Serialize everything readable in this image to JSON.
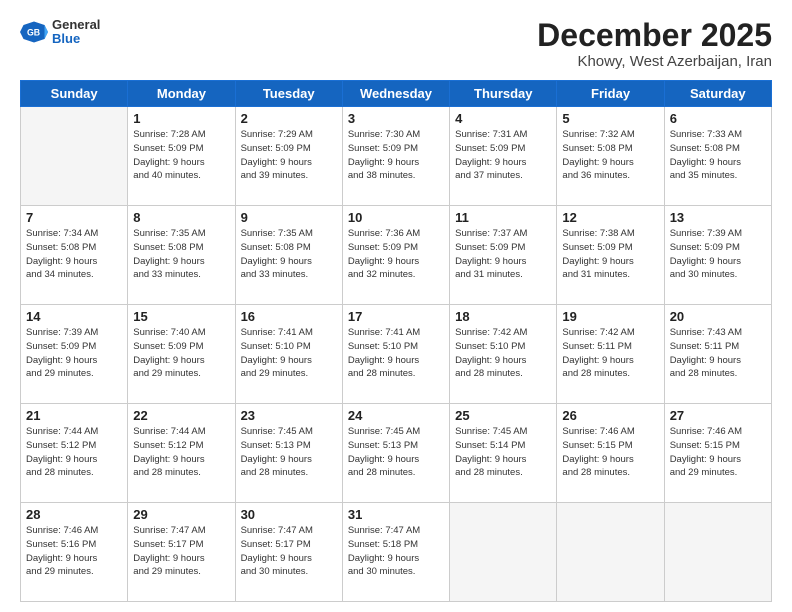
{
  "logo": {
    "general": "General",
    "blue": "Blue"
  },
  "header": {
    "month": "December 2025",
    "location": "Khowy, West Azerbaijan, Iran"
  },
  "weekdays": [
    "Sunday",
    "Monday",
    "Tuesday",
    "Wednesday",
    "Thursday",
    "Friday",
    "Saturday"
  ],
  "weeks": [
    [
      {
        "day": "",
        "info": ""
      },
      {
        "day": "1",
        "info": "Sunrise: 7:28 AM\nSunset: 5:09 PM\nDaylight: 9 hours\nand 40 minutes."
      },
      {
        "day": "2",
        "info": "Sunrise: 7:29 AM\nSunset: 5:09 PM\nDaylight: 9 hours\nand 39 minutes."
      },
      {
        "day": "3",
        "info": "Sunrise: 7:30 AM\nSunset: 5:09 PM\nDaylight: 9 hours\nand 38 minutes."
      },
      {
        "day": "4",
        "info": "Sunrise: 7:31 AM\nSunset: 5:09 PM\nDaylight: 9 hours\nand 37 minutes."
      },
      {
        "day": "5",
        "info": "Sunrise: 7:32 AM\nSunset: 5:08 PM\nDaylight: 9 hours\nand 36 minutes."
      },
      {
        "day": "6",
        "info": "Sunrise: 7:33 AM\nSunset: 5:08 PM\nDaylight: 9 hours\nand 35 minutes."
      }
    ],
    [
      {
        "day": "7",
        "info": "Sunrise: 7:34 AM\nSunset: 5:08 PM\nDaylight: 9 hours\nand 34 minutes."
      },
      {
        "day": "8",
        "info": "Sunrise: 7:35 AM\nSunset: 5:08 PM\nDaylight: 9 hours\nand 33 minutes."
      },
      {
        "day": "9",
        "info": "Sunrise: 7:35 AM\nSunset: 5:08 PM\nDaylight: 9 hours\nand 33 minutes."
      },
      {
        "day": "10",
        "info": "Sunrise: 7:36 AM\nSunset: 5:09 PM\nDaylight: 9 hours\nand 32 minutes."
      },
      {
        "day": "11",
        "info": "Sunrise: 7:37 AM\nSunset: 5:09 PM\nDaylight: 9 hours\nand 31 minutes."
      },
      {
        "day": "12",
        "info": "Sunrise: 7:38 AM\nSunset: 5:09 PM\nDaylight: 9 hours\nand 31 minutes."
      },
      {
        "day": "13",
        "info": "Sunrise: 7:39 AM\nSunset: 5:09 PM\nDaylight: 9 hours\nand 30 minutes."
      }
    ],
    [
      {
        "day": "14",
        "info": "Sunrise: 7:39 AM\nSunset: 5:09 PM\nDaylight: 9 hours\nand 29 minutes."
      },
      {
        "day": "15",
        "info": "Sunrise: 7:40 AM\nSunset: 5:09 PM\nDaylight: 9 hours\nand 29 minutes."
      },
      {
        "day": "16",
        "info": "Sunrise: 7:41 AM\nSunset: 5:10 PM\nDaylight: 9 hours\nand 29 minutes."
      },
      {
        "day": "17",
        "info": "Sunrise: 7:41 AM\nSunset: 5:10 PM\nDaylight: 9 hours\nand 28 minutes."
      },
      {
        "day": "18",
        "info": "Sunrise: 7:42 AM\nSunset: 5:10 PM\nDaylight: 9 hours\nand 28 minutes."
      },
      {
        "day": "19",
        "info": "Sunrise: 7:42 AM\nSunset: 5:11 PM\nDaylight: 9 hours\nand 28 minutes."
      },
      {
        "day": "20",
        "info": "Sunrise: 7:43 AM\nSunset: 5:11 PM\nDaylight: 9 hours\nand 28 minutes."
      }
    ],
    [
      {
        "day": "21",
        "info": "Sunrise: 7:44 AM\nSunset: 5:12 PM\nDaylight: 9 hours\nand 28 minutes."
      },
      {
        "day": "22",
        "info": "Sunrise: 7:44 AM\nSunset: 5:12 PM\nDaylight: 9 hours\nand 28 minutes."
      },
      {
        "day": "23",
        "info": "Sunrise: 7:45 AM\nSunset: 5:13 PM\nDaylight: 9 hours\nand 28 minutes."
      },
      {
        "day": "24",
        "info": "Sunrise: 7:45 AM\nSunset: 5:13 PM\nDaylight: 9 hours\nand 28 minutes."
      },
      {
        "day": "25",
        "info": "Sunrise: 7:45 AM\nSunset: 5:14 PM\nDaylight: 9 hours\nand 28 minutes."
      },
      {
        "day": "26",
        "info": "Sunrise: 7:46 AM\nSunset: 5:15 PM\nDaylight: 9 hours\nand 28 minutes."
      },
      {
        "day": "27",
        "info": "Sunrise: 7:46 AM\nSunset: 5:15 PM\nDaylight: 9 hours\nand 29 minutes."
      }
    ],
    [
      {
        "day": "28",
        "info": "Sunrise: 7:46 AM\nSunset: 5:16 PM\nDaylight: 9 hours\nand 29 minutes."
      },
      {
        "day": "29",
        "info": "Sunrise: 7:47 AM\nSunset: 5:17 PM\nDaylight: 9 hours\nand 29 minutes."
      },
      {
        "day": "30",
        "info": "Sunrise: 7:47 AM\nSunset: 5:17 PM\nDaylight: 9 hours\nand 30 minutes."
      },
      {
        "day": "31",
        "info": "Sunrise: 7:47 AM\nSunset: 5:18 PM\nDaylight: 9 hours\nand 30 minutes."
      },
      {
        "day": "",
        "info": ""
      },
      {
        "day": "",
        "info": ""
      },
      {
        "day": "",
        "info": ""
      }
    ]
  ]
}
